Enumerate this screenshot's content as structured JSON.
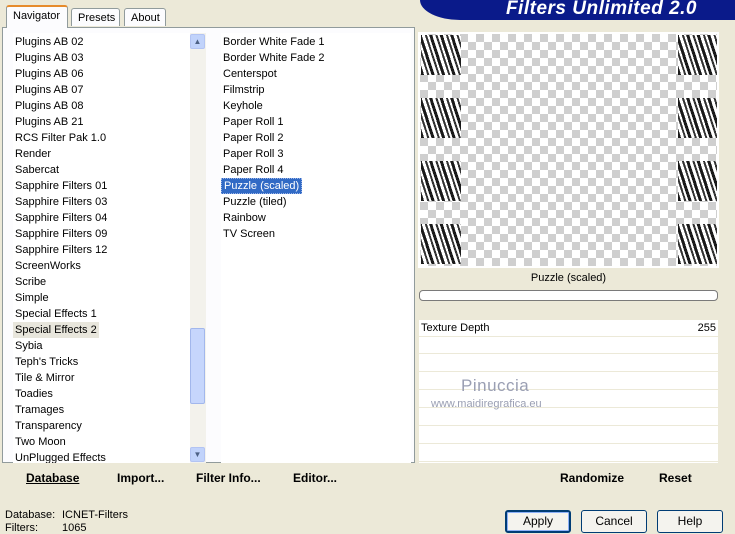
{
  "tabs": [
    "Navigator",
    "Presets",
    "About"
  ],
  "banner_title": "Filters Unlimited 2.0",
  "categories": [
    "Plugins AB 02",
    "Plugins AB 03",
    "Plugins AB 06",
    "Plugins AB 07",
    "Plugins AB 08",
    "Plugins AB 21",
    "RCS Filter Pak 1.0",
    "Render",
    "Sabercat",
    "Sapphire Filters 01",
    "Sapphire Filters 03",
    "Sapphire Filters 04",
    "Sapphire Filters 09",
    "Sapphire Filters 12",
    "ScreenWorks",
    "Scribe",
    "Simple",
    "Special Effects 1",
    "Special Effects 2",
    "Sybia",
    "Teph's Tricks",
    "Tile & Mirror",
    "Toadies",
    "Tramages",
    "Transparency",
    "Two Moon",
    "UnPlugged Effects"
  ],
  "selected_category": "Special Effects 2",
  "filters": [
    "Border White Fade 1",
    "Border White Fade 2",
    "Centerspot",
    "Filmstrip",
    "Keyhole",
    "Paper Roll 1",
    "Paper Roll 2",
    "Paper Roll 3",
    "Paper Roll 4",
    "Puzzle (scaled)",
    "Puzzle (tiled)",
    "Rainbow",
    "TV Screen"
  ],
  "selected_filter": "Puzzle (scaled)",
  "left_buttons": {
    "database": "Database",
    "import": "Import...",
    "filter_info": "Filter Info...",
    "editor": "Editor..."
  },
  "preview_caption": "Puzzle (scaled)",
  "params": [
    {
      "name": "Texture Depth",
      "value": "255"
    }
  ],
  "watermark": {
    "name": "Pinuccia",
    "url": "www.maidiregrafica.eu"
  },
  "right_buttons": {
    "randomize": "Randomize",
    "reset": "Reset"
  },
  "status": {
    "database_label": "Database:",
    "database_value": "ICNET-Filters",
    "filters_label": "Filters:",
    "filters_value": "1065"
  },
  "dialog_buttons": {
    "apply": "Apply",
    "cancel": "Cancel",
    "help": "Help"
  }
}
